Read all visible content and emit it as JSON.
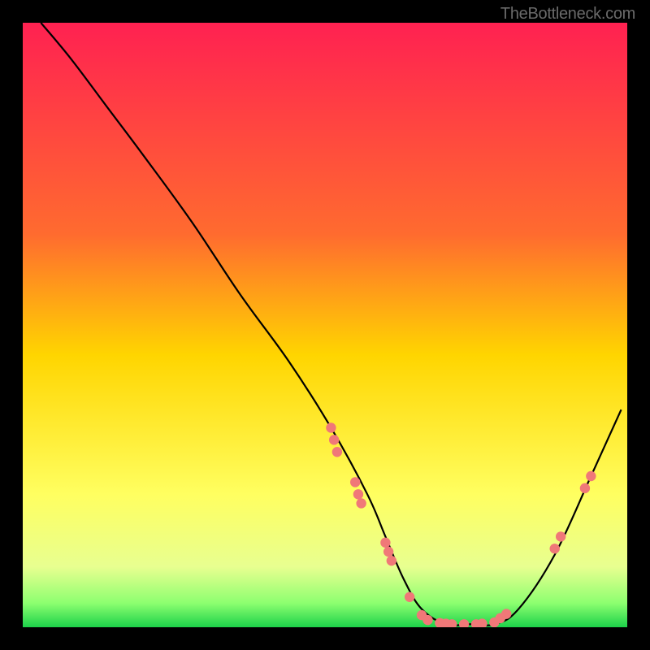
{
  "watermark": "TheBottleneck.com",
  "chart_data": {
    "type": "line",
    "title": "",
    "xlabel": "",
    "ylabel": "",
    "xlim": [
      0,
      100
    ],
    "ylim": [
      0,
      100
    ],
    "gradient_stops": [
      {
        "offset": 0,
        "color": "#ff2151"
      },
      {
        "offset": 35,
        "color": "#ff6b2f"
      },
      {
        "offset": 55,
        "color": "#ffd500"
      },
      {
        "offset": 78,
        "color": "#ffff60"
      },
      {
        "offset": 90,
        "color": "#e8ff90"
      },
      {
        "offset": 96,
        "color": "#8dff70"
      },
      {
        "offset": 100,
        "color": "#1cd24a"
      }
    ],
    "curve": {
      "x": [
        3,
        8,
        14,
        20,
        28,
        36,
        44,
        51,
        57,
        60,
        63,
        66,
        70,
        74,
        78,
        82,
        88,
        94,
        99
      ],
      "y": [
        100,
        94,
        86,
        78,
        67,
        55,
        44,
        33,
        22,
        15,
        8,
        3,
        0.5,
        0.5,
        0.5,
        3,
        12,
        25,
        36
      ]
    },
    "markers": [
      {
        "x": 51,
        "y": 33
      },
      {
        "x": 51.5,
        "y": 31
      },
      {
        "x": 52,
        "y": 29
      },
      {
        "x": 55,
        "y": 24
      },
      {
        "x": 55.5,
        "y": 22
      },
      {
        "x": 56,
        "y": 20.5
      },
      {
        "x": 60,
        "y": 14
      },
      {
        "x": 60.5,
        "y": 12.5
      },
      {
        "x": 61,
        "y": 11
      },
      {
        "x": 64,
        "y": 5
      },
      {
        "x": 66,
        "y": 2
      },
      {
        "x": 67,
        "y": 1.2
      },
      {
        "x": 69,
        "y": 0.7
      },
      {
        "x": 70,
        "y": 0.6
      },
      {
        "x": 71,
        "y": 0.5
      },
      {
        "x": 73,
        "y": 0.5
      },
      {
        "x": 75,
        "y": 0.5
      },
      {
        "x": 76,
        "y": 0.6
      },
      {
        "x": 78,
        "y": 0.8
      },
      {
        "x": 79,
        "y": 1.5
      },
      {
        "x": 80,
        "y": 2.2
      },
      {
        "x": 88,
        "y": 13
      },
      {
        "x": 89,
        "y": 15
      },
      {
        "x": 93,
        "y": 23
      },
      {
        "x": 94,
        "y": 25
      }
    ],
    "marker_color": "#f07878",
    "curve_color": "#000000"
  }
}
